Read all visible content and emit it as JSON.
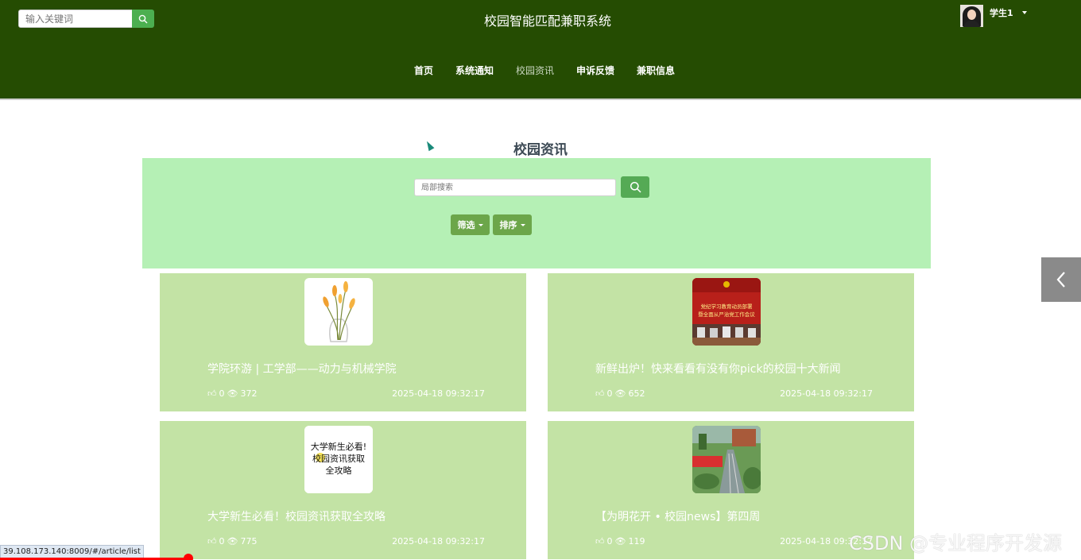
{
  "header": {
    "search_placeholder": "输入关键词",
    "site_title": "校园智能匹配兼职系统",
    "user_name": "学生1"
  },
  "nav": {
    "items": [
      {
        "label": "首页"
      },
      {
        "label": "系统通知"
      },
      {
        "label": "校园资讯"
      },
      {
        "label": "申诉反馈"
      },
      {
        "label": "兼职信息"
      }
    ],
    "active": "校园资讯"
  },
  "main": {
    "title": "校园资讯",
    "search_placeholder": "局部搜索",
    "filter_label": "筛选",
    "sort_label": "排序"
  },
  "articles": [
    {
      "title": "学院环游 | 工学部——动力与机械学院",
      "likes": "0",
      "views": "372",
      "date": "2025-04-18 09:32:17"
    },
    {
      "title": "新鲜出炉！快来看看有没有你pick的校园十大新闻",
      "likes": "0",
      "views": "652",
      "date": "2025-04-18 09:32:17"
    },
    {
      "title": "大学新生必看！校园资讯获取全攻略",
      "likes": "0",
      "views": "775",
      "date": "2025-04-18 09:32:17"
    },
    {
      "title": "【为明花开 • 校园news】第四周",
      "likes": "0",
      "views": "119",
      "date": "2025-04-18 09:32:17"
    }
  ],
  "thumbs": {
    "poster_text": [
      "党纪学习教育动员部署",
      "暨全面从严治党工作会议"
    ],
    "guide_text": [
      "大学新生必看!",
      "校园资讯获取",
      "全攻略"
    ]
  },
  "status_bar": {
    "url": "39.108.173.140:8009/#/article/list"
  },
  "watermark": "CSDN @专业程序开发源",
  "colors": {
    "header_bg": "#254c02",
    "panel_bg": "#b5f0b5",
    "card_bg": "#c3e3a5",
    "button_green": "#6ca64a"
  }
}
